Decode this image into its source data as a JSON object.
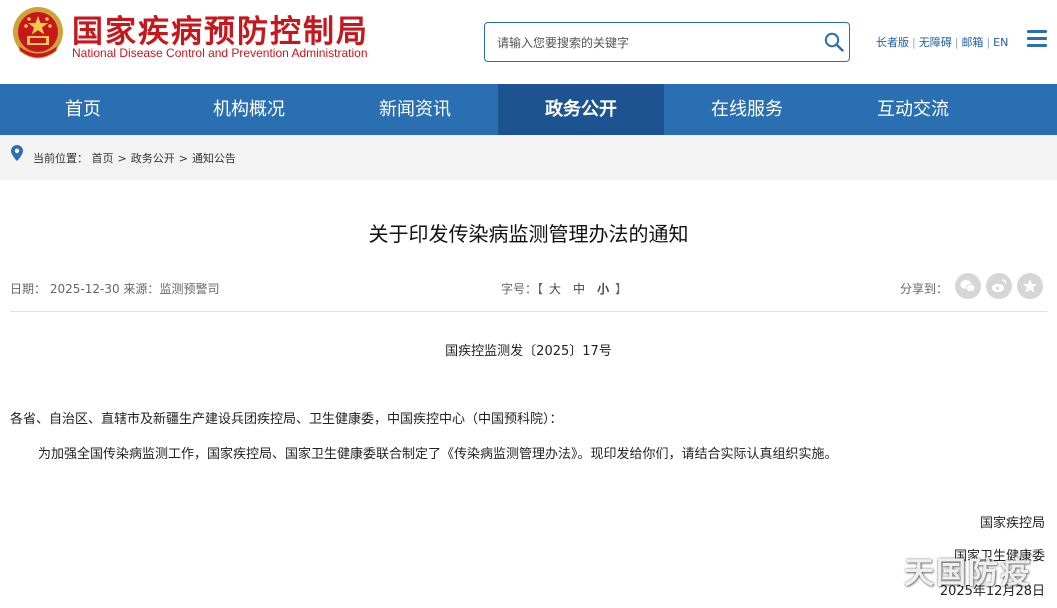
{
  "header": {
    "title_cn": "国家疾病预防控制局",
    "title_en": "National Disease Control and Prevention Administration",
    "search_placeholder": "请输入您要搜索的关键字",
    "links": [
      "长者版",
      "无障碍",
      "邮箱",
      "EN"
    ],
    "brand_color": "#c8161d"
  },
  "nav": {
    "items": [
      {
        "label": "首页"
      },
      {
        "label": "机构概况"
      },
      {
        "label": "新闻资讯"
      },
      {
        "label": "政务公开"
      },
      {
        "label": "在线服务"
      },
      {
        "label": "互动交流"
      }
    ],
    "active_index": 3,
    "bg_color": "#2b6fb3",
    "active_color": "#1c5390"
  },
  "breadcrumb": {
    "prefix": "当前位置：",
    "items": [
      "首页",
      "政务公开",
      "通知公告"
    ],
    "separator": ">"
  },
  "article": {
    "title": "关于印发传染病监测管理办法的通知",
    "date_label": "日期：",
    "date": "2025-12-30",
    "source_label": "来源：",
    "source": "监测预警司",
    "font_label": "字号：",
    "font_open": "【",
    "font_sizes": [
      "大",
      "中",
      "小"
    ],
    "font_close": "】",
    "share_label": "分享到：",
    "share_icons": [
      "wechat-icon",
      "weibo-icon",
      "favorite-icon"
    ],
    "doc_number": "国疾控监测发〔2025〕17号",
    "recipients": "各省、自治区、直辖市及新疆生产建设兵团疾控局、卫生健康委，中国疾控中心（中国预科院）：",
    "body": "为加强全国传染病监测工作，国家疾控局、国家卫生健康委联合制定了《传染病监测管理办法》。现印发给你们，请结合实际认真组织实施。",
    "signatories": [
      "国家疾控局",
      "国家卫生健康委"
    ],
    "sign_date": "2025年12月28日"
  },
  "watermark": "天国防疫"
}
